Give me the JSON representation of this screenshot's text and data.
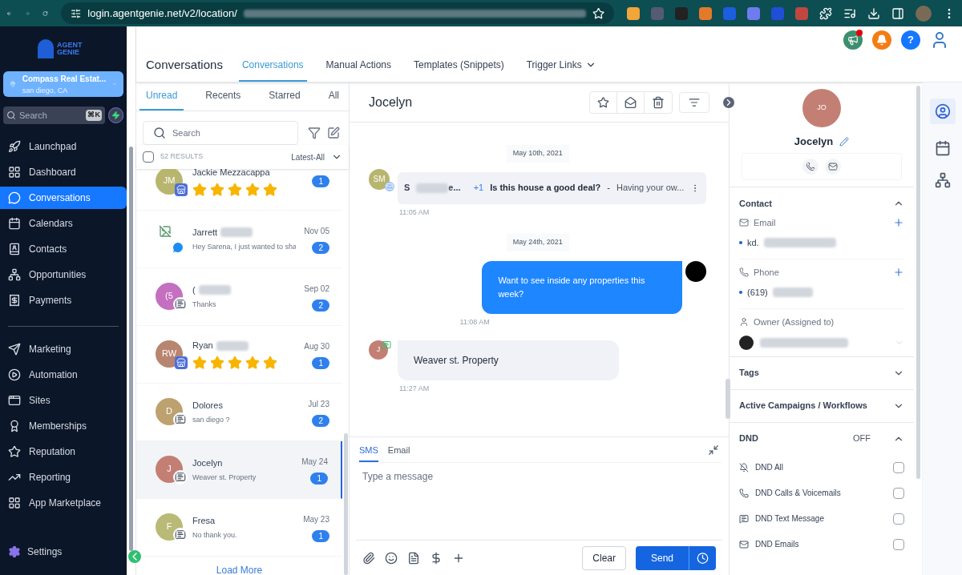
{
  "browser": {
    "url": "login.agentgenie.net/v2/location/"
  },
  "sidebar": {
    "logo": "AGENT GENIE",
    "location": {
      "name": "Compass Real Estat...",
      "city": "san diego, CA"
    },
    "search": {
      "placeholder": "Search",
      "shortcut": "⌘K"
    },
    "nav_groups": [
      [
        {
          "label": "Launchpad",
          "selected": false
        },
        {
          "label": "Dashboard",
          "selected": false
        },
        {
          "label": "Conversations",
          "selected": true
        },
        {
          "label": "Calendars",
          "selected": false
        },
        {
          "label": "Contacts",
          "selected": false
        },
        {
          "label": "Opportunities",
          "selected": false
        },
        {
          "label": "Payments",
          "selected": false
        }
      ],
      [
        {
          "label": "Marketing",
          "selected": false
        },
        {
          "label": "Automation",
          "selected": false
        },
        {
          "label": "Sites",
          "selected": false
        },
        {
          "label": "Memberships",
          "selected": false
        },
        {
          "label": "Reputation",
          "selected": false
        },
        {
          "label": "Reporting",
          "selected": false
        },
        {
          "label": "App Marketplace",
          "selected": false
        }
      ]
    ],
    "settings": "Settings"
  },
  "header": {
    "title": "Conversations",
    "tabs": [
      {
        "label": "Conversations",
        "selected": true
      },
      {
        "label": "Manual Actions",
        "selected": false
      },
      {
        "label": "Templates (Snippets)",
        "selected": false
      },
      {
        "label": "Trigger Links",
        "selected": false
      }
    ],
    "help": "?"
  },
  "list": {
    "tabs": [
      {
        "label": "Unread",
        "selected": true
      },
      {
        "label": "Recents",
        "selected": false
      },
      {
        "label": "Starred",
        "selected": false
      },
      {
        "label": "All",
        "selected": false
      }
    ],
    "search": {
      "placeholder": "Search"
    },
    "select_all": {
      "checked": false
    },
    "results": "52 RESULTS",
    "sort": "Latest-All",
    "items": [
      {
        "kind": "review",
        "initials": "JM",
        "color": "#b8b56f",
        "name": "Jackie Mezzacappa",
        "stars": 5,
        "count": "1",
        "selected": false
      },
      {
        "kind": "messenger",
        "name": "Jarrett",
        "preview": "Hey Sarena, I just wanted to sha",
        "date": "Nov 05",
        "count": "2",
        "selected": false
      },
      {
        "kind": "sms",
        "initials": "(5",
        "color": "#c46fc0",
        "name": "(",
        "preview": "Thanks",
        "date": "Sep 02",
        "count": "2",
        "selected": false
      },
      {
        "kind": "review",
        "initials": "RW",
        "color": "#b88570",
        "name": "Ryan",
        "stars": 5,
        "date": "Aug 30",
        "count": "1",
        "selected": false
      },
      {
        "kind": "sms",
        "initials": "D",
        "color": "#bda26f",
        "name": "Dolores",
        "preview": "san diego ?",
        "date": "Jul 23",
        "count": "2",
        "selected": false
      },
      {
        "kind": "sms",
        "initials": "J",
        "color": "#c47f74",
        "name": "Jocelyn",
        "preview": "Weaver st. Property",
        "date": "May 24",
        "count": "1",
        "selected": true
      },
      {
        "kind": "sms",
        "initials": "F",
        "color": "#b9ba76",
        "name": "Fresa",
        "preview": "No thank you.",
        "date": "May 23",
        "count": "1",
        "selected": false
      }
    ],
    "load_more": "Load More"
  },
  "chat": {
    "title": "Jocelyn",
    "messages": [
      {
        "kind": "date",
        "text": "May 10th, 2021"
      },
      {
        "kind": "email",
        "initials": "SM",
        "sender": "S",
        "sender_end": "e...",
        "extra": "+1",
        "subject": "Is this house a good deal?",
        "separator": "-",
        "snippet": "Having your ow...",
        "time": "11:05 AM"
      },
      {
        "kind": "date",
        "text": "May 24th, 2021"
      },
      {
        "kind": "outgoing",
        "text": "Want to see inside any properties this week?",
        "time": "11:08 AM"
      },
      {
        "kind": "incoming",
        "initials": "J",
        "text": "Weaver st. Property",
        "time": "11:27 AM"
      }
    ],
    "composer": {
      "tabs": [
        {
          "label": "SMS",
          "selected": true
        },
        {
          "label": "Email",
          "selected": false
        }
      ],
      "placeholder": "Type a message",
      "clear": "Clear",
      "send": "Send"
    }
  },
  "contact": {
    "initials": "JO",
    "name": "Jocelyn",
    "section": "Contact",
    "email_label": "Email",
    "email": "kd.",
    "phone_label": "Phone",
    "phone": "(619)",
    "owner_label": "Owner (Assigned to)",
    "sections": [
      {
        "title": "Tags",
        "expanded": false
      },
      {
        "title": "Active Campaigns / Workflows",
        "expanded": false
      }
    ],
    "dnd": {
      "title": "DND",
      "status": "OFF",
      "expanded": true,
      "options": [
        {
          "label": "DND All",
          "checked": false
        },
        {
          "label": "DND Calls & Voicemails",
          "checked": false
        },
        {
          "label": "DND Text Message",
          "checked": false
        },
        {
          "label": "DND Emails",
          "checked": false
        }
      ]
    }
  }
}
